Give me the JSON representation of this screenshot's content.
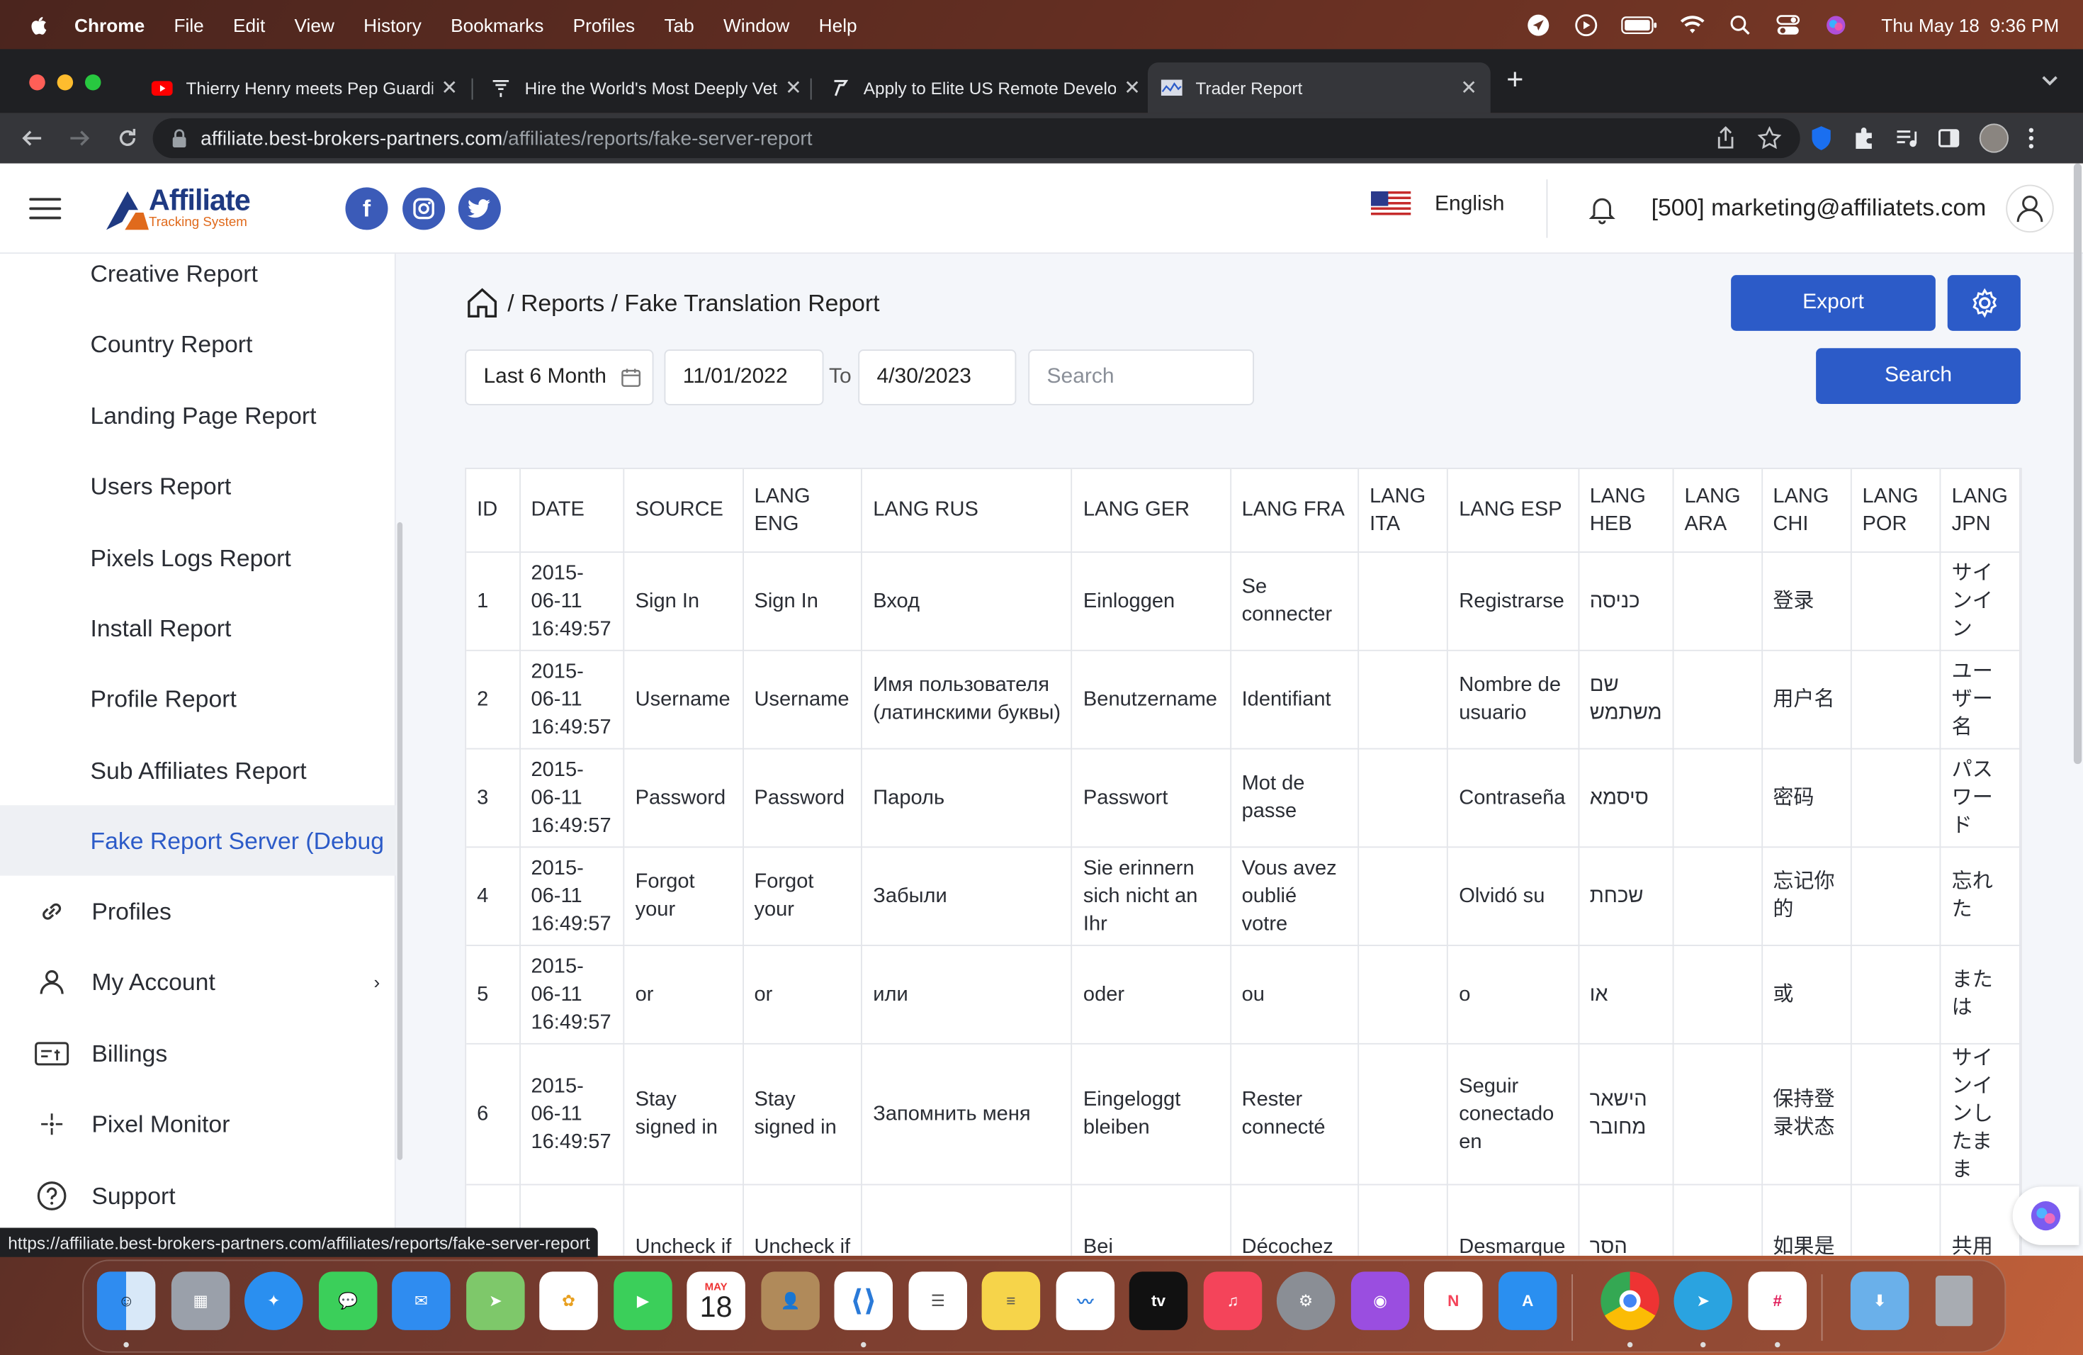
{
  "menubar": {
    "app": "Chrome",
    "items": [
      "File",
      "Edit",
      "View",
      "History",
      "Bookmarks",
      "Profiles",
      "Tab",
      "Window",
      "Help"
    ],
    "datetime": "Thu May 18  9:36 PM"
  },
  "tabs": [
    {
      "title": "Thierry Henry meets Pep Guardiola",
      "icon": "youtube-icon"
    },
    {
      "title": "Hire the World's Most Deeply Vetted",
      "icon": "turing-icon"
    },
    {
      "title": "Apply to Elite US Remote Developer",
      "icon": "turing-t-icon"
    },
    {
      "title": "Trader Report",
      "icon": "report-favicon"
    }
  ],
  "url": {
    "host": "affiliate.best-brokers-partners.com",
    "path": "/affiliates/reports/fake-server-report"
  },
  "header": {
    "logo_main": "Affiliate",
    "logo_sub": "Tracking System",
    "language": "English",
    "user": "[500] marketing@affiliatets.com"
  },
  "sidebar": {
    "report_items": [
      "Creative Report",
      "Country Report",
      "Landing Page Report",
      "Users Report",
      "Pixels Logs Report",
      "Install Report",
      "Profile Report",
      "Sub Affiliates Report",
      "Fake Report Server (Debug"
    ],
    "active_index": 8,
    "top_items": [
      {
        "label": "Profiles",
        "icon": "link-icon"
      },
      {
        "label": "My Account",
        "icon": "person-icon"
      },
      {
        "label": "Billings",
        "icon": "billing-icon"
      },
      {
        "label": "Pixel Monitor",
        "icon": "pixel-monitor-icon"
      },
      {
        "label": "Support",
        "icon": "help-icon"
      }
    ]
  },
  "breadcrumb": {
    "section": "Reports",
    "page": "Fake Translation Report",
    "sep": "/"
  },
  "buttons": {
    "export": "Export",
    "search": "Search"
  },
  "filters": {
    "period": "Last 6 Month",
    "from": "11/01/2022",
    "to_label": "To",
    "to": "4/30/2023",
    "search_placeholder": "Search"
  },
  "table": {
    "headers": [
      "ID",
      "DATE",
      "SOURCE",
      "LANG ENG",
      "LANG RUS",
      "LANG GER",
      "LANG FRA",
      "LANG ITA",
      "LANG ESP",
      "LANG HEB",
      "LANG ARA",
      "LANG CHI",
      "LANG POR",
      "LANG JPN"
    ],
    "rows": [
      [
        "1",
        "2015-06-11 16:49:57",
        "Sign In",
        "Sign In",
        "Вход",
        "Einloggen",
        "Se connecter",
        "",
        "Registrarse",
        "כניסה",
        "",
        "登录",
        "",
        "サインイン"
      ],
      [
        "2",
        "2015-06-11 16:49:57",
        "Username",
        "Username",
        "Имя пользователя (латинскими буквы)",
        "Benutzername",
        "Identifiant",
        "",
        "Nombre de usuario",
        "שם משתמש",
        "",
        "用户名",
        "",
        "ユーザー名"
      ],
      [
        "3",
        "2015-06-11 16:49:57",
        "Password",
        "Password",
        "Пароль",
        "Passwort",
        "Mot de passe",
        "",
        "Contraseña",
        "סיסמא",
        "",
        "密码",
        "",
        "パスワード"
      ],
      [
        "4",
        "2015-06-11 16:49:57",
        "Forgot your",
        "Forgot your",
        "Забыли",
        "Sie erinnern sich nicht an Ihr",
        "Vous avez oublié votre",
        "",
        "Olvidó su",
        "שכחת",
        "",
        "忘记你的",
        "",
        "忘れた"
      ],
      [
        "5",
        "2015-06-11 16:49:57",
        "or",
        "or",
        "или",
        "oder",
        "ou",
        "",
        "o",
        "או",
        "",
        "或",
        "",
        "または"
      ],
      [
        "6",
        "2015-06-11 16:49:57",
        "Stay signed in",
        "Stay signed in",
        "Запомнить меня",
        "Eingeloggt bleiben",
        "Rester connecté",
        "",
        "Seguir conectado en",
        "הישאר מחובר",
        "",
        "保持登录状态",
        "",
        "サインインしたまま"
      ],
      [
        "",
        "",
        "Uncheck if you're",
        "Uncheck if you're",
        "",
        "Bei gemeinsam",
        "Décochez si vous",
        "",
        "Desmarque esta casilla",
        "הסר",
        "",
        "如果是公用计",
        "",
        "共用"
      ]
    ]
  },
  "status_url": "https://affiliate.best-brokers-partners.com/affiliates/reports/fake-server-report",
  "dock": {
    "calendar_month": "MAY",
    "calendar_day": "18",
    "apps": [
      "finder-icon",
      "launchpad-icon",
      "safari-icon",
      "messages-icon",
      "mail-icon",
      "maps-icon",
      "photos-icon",
      "facetime-icon",
      "calendar-icon",
      "contacts-icon",
      "vscode-icon",
      "reminders-icon",
      "notes-icon",
      "freeform-icon",
      "appletv-icon",
      "music-icon",
      "system-settings-icon",
      "podcasts-icon",
      "news-icon",
      "appstore-icon",
      "chrome-icon",
      "telegram-icon",
      "slack-icon",
      "downloads-icon",
      "trash-icon"
    ]
  }
}
